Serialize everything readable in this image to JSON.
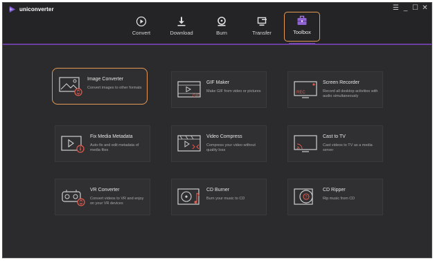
{
  "app": {
    "name": "uniconverter"
  },
  "window_controls": {
    "menu": "☰",
    "minimize": "_",
    "maximize": "☐",
    "close": "✕"
  },
  "nav": [
    {
      "label": "Convert",
      "icon": "convert-icon"
    },
    {
      "label": "Download",
      "icon": "download-icon"
    },
    {
      "label": "Burn",
      "icon": "burn-icon"
    },
    {
      "label": "Transfer",
      "icon": "transfer-icon"
    },
    {
      "label": "Toolbox",
      "icon": "toolbox-icon",
      "active": true
    }
  ],
  "tools": [
    {
      "title": "Image Converter",
      "desc": "Convert images to other formats",
      "icon": "image-converter-icon"
    },
    {
      "title": "GIF Maker",
      "desc": "Make GIF from video or pictures",
      "icon": "gif-maker-icon"
    },
    {
      "title": "Screen Recorder",
      "desc": "Record all desktop activities with audio simultaneously",
      "icon": "screen-recorder-icon"
    },
    {
      "title": "Fix Media Metadata",
      "desc": "Auto-fix and edit metadata of media files",
      "icon": "metadata-icon"
    },
    {
      "title": "Video Compress",
      "desc": "Compress your video without quality loss",
      "icon": "video-compress-icon"
    },
    {
      "title": "Cast to TV",
      "desc": "Cast videos to TV as a media server",
      "icon": "cast-tv-icon"
    },
    {
      "title": "VR Converter",
      "desc": "Convert videos to VR and enjoy on your VR devices",
      "icon": "vr-icon"
    },
    {
      "title": "CD Burner",
      "desc": "Burn your music to CD",
      "icon": "cd-burner-icon"
    },
    {
      "title": "CD Ripper",
      "desc": "Rip music from CD",
      "icon": "cd-ripper-icon"
    }
  ],
  "icon_badges": {
    "gif": "GIF",
    "rec": "REC"
  },
  "colors": {
    "accent_orange": "#e49b56",
    "accent_purple": "#6b3fa0",
    "badge_red": "#e25a4e",
    "background": "#2b2b2e"
  }
}
